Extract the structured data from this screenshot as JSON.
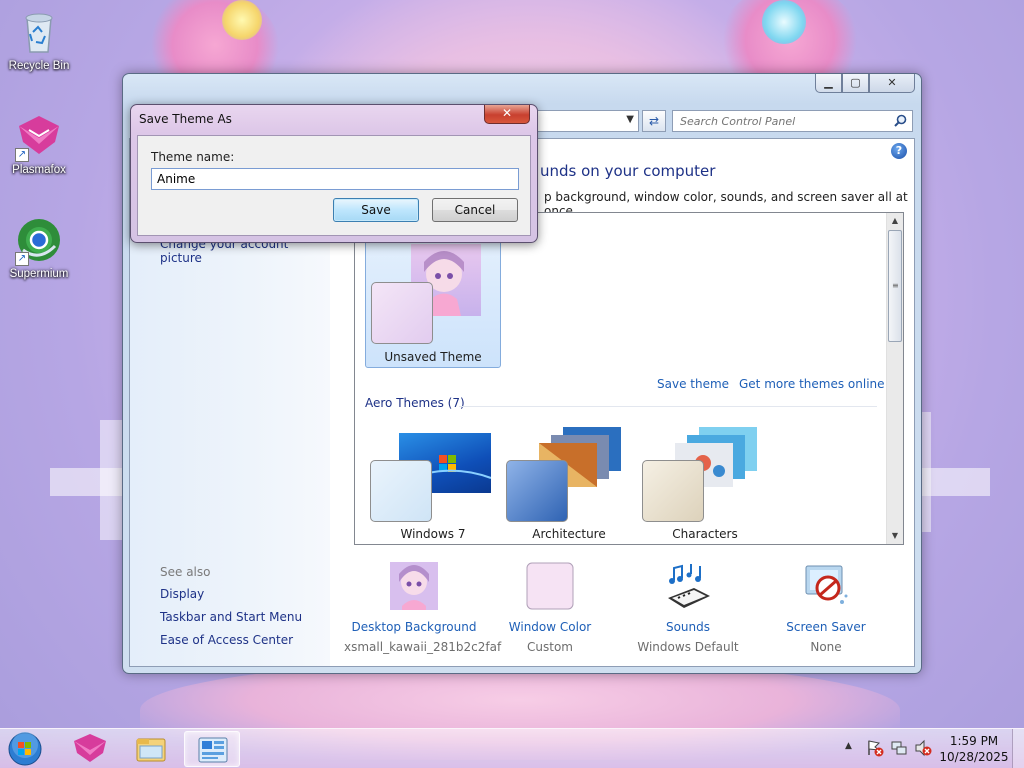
{
  "desktop": {
    "icons": [
      {
        "label": "Recycle Bin",
        "icon": "recycle-bin-icon"
      },
      {
        "label": "Plasmafox",
        "icon": "plasmafox-icon"
      },
      {
        "label": "Supermium",
        "icon": "supermium-icon"
      }
    ]
  },
  "control_panel": {
    "search_placeholder": "Search Control Panel",
    "heading": "unds on your computer",
    "subheading": "p background, window color, sounds, and screen saver all at once.",
    "left_link_partial": "Change your account picture",
    "see_also": {
      "label": "See also",
      "links": [
        "Display",
        "Taskbar and Start Menu",
        "Ease of Access Center"
      ]
    },
    "my_themes": {
      "items": [
        {
          "label": "Unsaved Theme",
          "selected": true
        }
      ],
      "save_link": "Save theme",
      "more_link": "Get more themes online"
    },
    "aero_themes": {
      "label": "Aero Themes (7)",
      "items": [
        {
          "label": "Windows 7"
        },
        {
          "label": "Architecture"
        },
        {
          "label": "Characters"
        }
      ]
    },
    "bottom": [
      {
        "title": "Desktop Background",
        "sub": "xsmall_kawaii_281b2c2faf",
        "icon": "desktop-background-icon"
      },
      {
        "title": "Window Color",
        "sub": "Custom",
        "icon": "window-color-icon"
      },
      {
        "title": "Sounds",
        "sub": "Windows Default",
        "icon": "sounds-icon"
      },
      {
        "title": "Screen Saver",
        "sub": "None",
        "icon": "screen-saver-icon"
      }
    ]
  },
  "dialog": {
    "title": "Save Theme As",
    "close_glyph": "✕",
    "label": "Theme name:",
    "value": "Anime",
    "save_label": "Save",
    "cancel_label": "Cancel"
  },
  "taskbar": {
    "time": "1:59 PM",
    "date": "10/28/2025",
    "apps": [
      "start-orb",
      "plasmafox-icon",
      "file-explorer-icon",
      "control-panel-icon"
    ]
  },
  "colors": {
    "link": "#1e5fb7",
    "heading": "#1e3287",
    "accent_selected": "#cde3fb"
  }
}
